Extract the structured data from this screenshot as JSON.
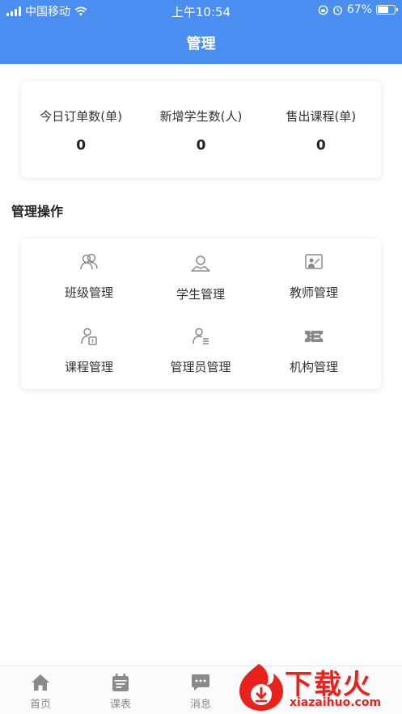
{
  "status_bar": {
    "carrier": "中国移动",
    "time": "上午10:54",
    "battery": "67%",
    "battery_level": 0.67
  },
  "header": {
    "title": "管理"
  },
  "stats": [
    {
      "label": "今日订单数(单)",
      "value": "0"
    },
    {
      "label": "新增学生数(人)",
      "value": "0"
    },
    {
      "label": "售出课程(单)",
      "value": "0"
    }
  ],
  "section": {
    "title": "管理操作"
  },
  "operations": [
    {
      "label": "班级管理",
      "icon": "class-group-icon"
    },
    {
      "label": "学生管理",
      "icon": "student-icon"
    },
    {
      "label": "教师管理",
      "icon": "teacher-board-icon"
    },
    {
      "label": "课程管理",
      "icon": "course-icon"
    },
    {
      "label": "管理员管理",
      "icon": "admin-user-icon"
    },
    {
      "label": "机构管理",
      "icon": "institution-icon"
    }
  ],
  "tabbar": {
    "tabs": [
      {
        "label": "首页",
        "icon": "home-icon"
      },
      {
        "label": "课表",
        "icon": "calendar-icon"
      },
      {
        "label": "消息",
        "icon": "message-icon"
      }
    ]
  },
  "watermark": {
    "title": "下载火",
    "subtitle": "xiazaihuo.com"
  },
  "colors": {
    "primary": "#4a8ef1",
    "icon_gray": "#8a8a8a",
    "watermark_red": "#e8231e"
  }
}
